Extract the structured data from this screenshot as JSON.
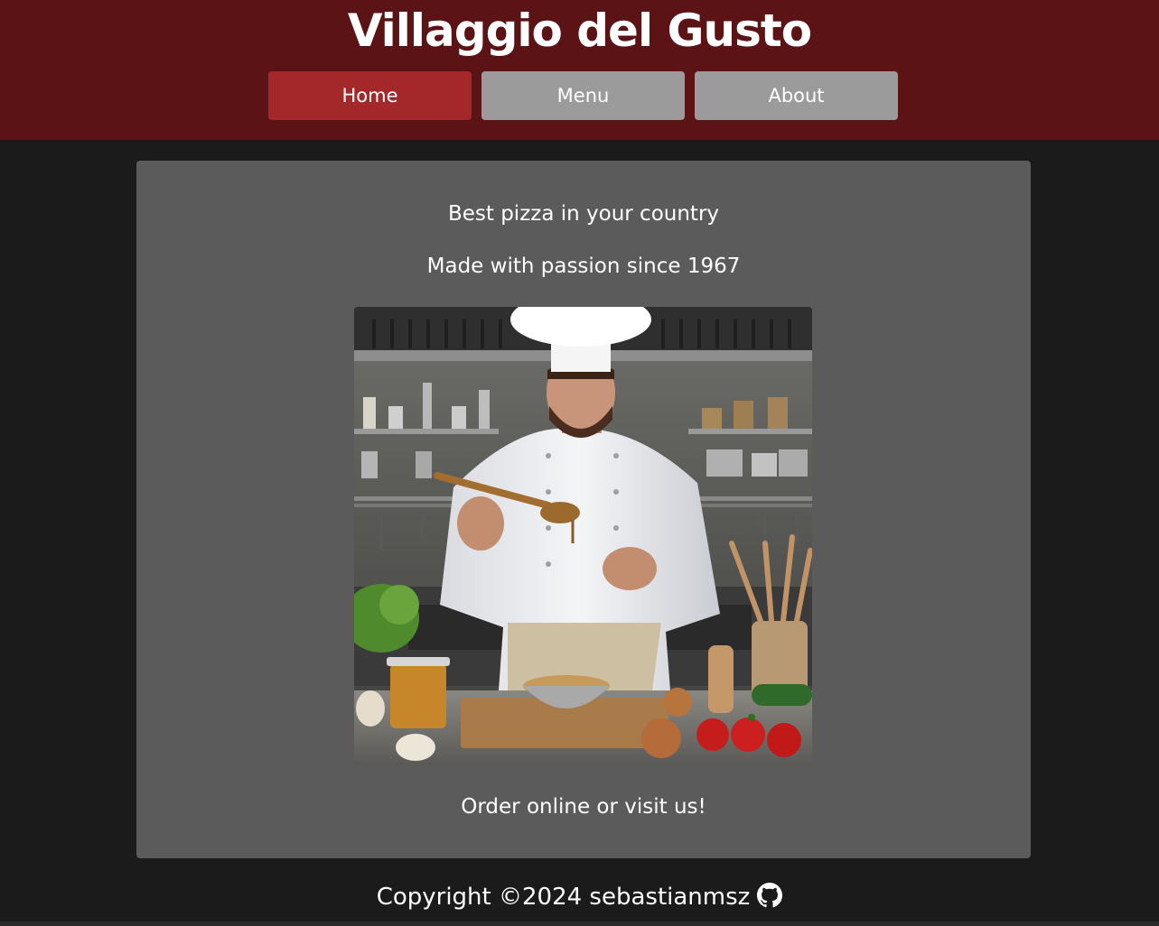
{
  "header": {
    "title": "Villaggio del Gusto",
    "background_color": "#5c1315"
  },
  "nav": {
    "items": [
      {
        "label": "Home",
        "active": true,
        "color": "#a4272a"
      },
      {
        "label": "Menu",
        "active": false,
        "color": "#9b9b9b"
      },
      {
        "label": "About",
        "active": false,
        "color": "#9b9b9b"
      }
    ]
  },
  "main": {
    "tagline": "Best pizza in your country",
    "subtitle": "Made with passion since 1967",
    "image": "chef tasting sauce in kitchen",
    "call_to_action": "Order online or visit us!"
  },
  "footer": {
    "copyright": "Copyright ©2024 sebastianmsz",
    "icon": "github-icon"
  }
}
